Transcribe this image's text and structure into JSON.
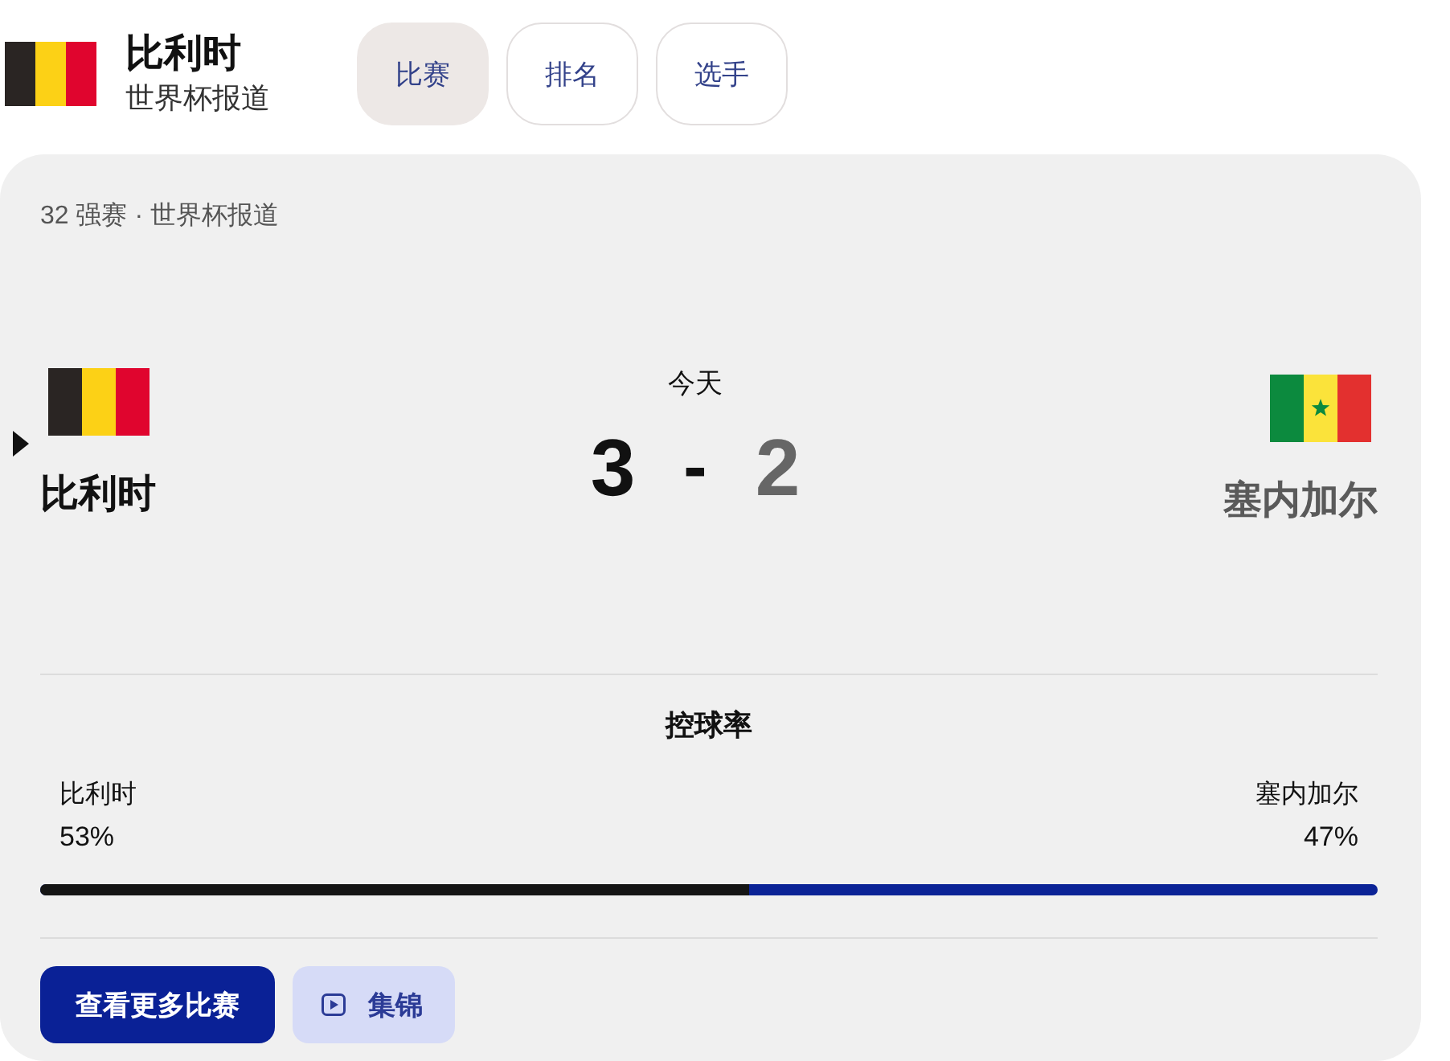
{
  "header": {
    "kind": "belgium",
    "title": "比利时",
    "subtitle": "世界杯报道"
  },
  "tabs": [
    {
      "label": "比赛",
      "selected": true
    },
    {
      "label": "排名",
      "selected": false
    },
    {
      "label": "选手",
      "selected": false
    }
  ],
  "match": {
    "stage": "32 强赛 · 世界杯报道",
    "date": "今天",
    "separator": "-",
    "teams": [
      {
        "kind": "belgium",
        "name": "比利时",
        "score": "3",
        "winner": true
      },
      {
        "kind": "senegal",
        "name": "塞内加尔",
        "score": "2",
        "winner": false
      }
    ]
  },
  "possession": {
    "title": "控球率",
    "level": 0.53,
    "teams": [
      {
        "name": "比利时",
        "value": "53%"
      },
      {
        "name": "塞内加尔",
        "value": "47%"
      }
    ]
  },
  "buttons": [
    {
      "kind": "primary",
      "label": "查看更多比赛"
    },
    {
      "kind": "video",
      "label": "集锦"
    }
  ]
}
